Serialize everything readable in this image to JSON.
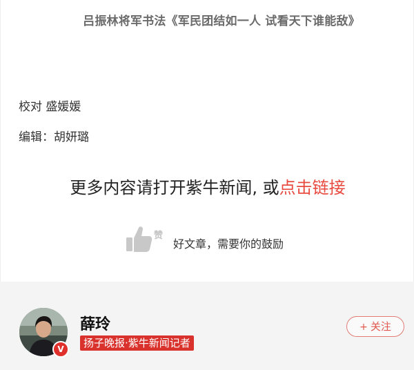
{
  "article": {
    "caption": "吕振林将军书法《军民团结如一人 试看天下谁能敌》",
    "proofreader": "校对 盛媛媛",
    "editor": "编辑：胡妍璐",
    "more_prefix": "更多内容请打开紫牛新闻, 或",
    "more_link": "点击链接"
  },
  "like": {
    "icon": "thumbs-up-icon",
    "zan_label": "赞",
    "encourage_text": "好文章，需要你的鼓励"
  },
  "author": {
    "name": "薛玲",
    "title": "扬子晚报·紫牛新闻记者",
    "verified_badge": "V",
    "follow_plus": "+",
    "follow_label": "关注"
  },
  "colors": {
    "accent_red": "#e84a3f",
    "badge_red": "#d9322d",
    "author_bg": "#f4f4f4"
  }
}
